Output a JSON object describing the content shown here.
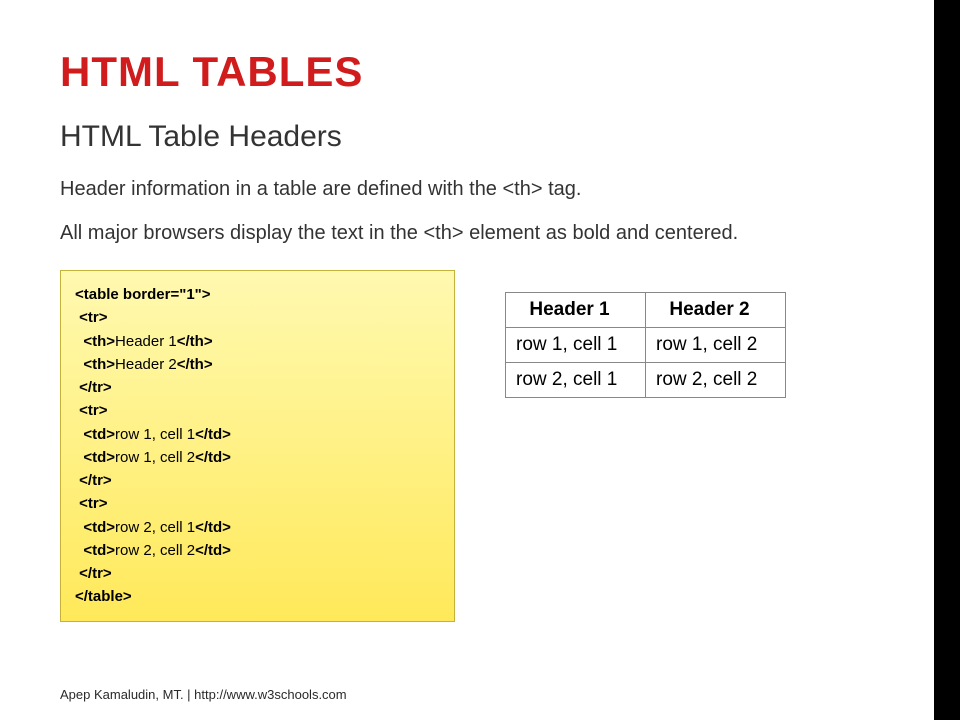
{
  "title": "HTML TABLES",
  "subtitle": "HTML Table Headers",
  "para1": "Header information in a table are defined with the <th> tag.",
  "para2": "All major browsers display the text in the <th> element as bold and centered.",
  "code": {
    "l1": "<table border=\"1\">",
    "l2": " <tr>",
    "l3a": "  <th>",
    "l3b": "Header 1",
    "l3c": "</th>",
    "l4a": "  <th>",
    "l4b": "Header 2",
    "l4c": "</th>",
    "l5": " </tr>",
    "l6": " <tr>",
    "l7a": "  <td>",
    "l7b": "row 1, cell 1",
    "l7c": "</td>",
    "l8a": "  <td>",
    "l8b": "row 1, cell 2",
    "l8c": "</td>",
    "l9": " </tr>",
    "l10": " <tr>",
    "l11a": "  <td>",
    "l11b": "row 2, cell 1",
    "l11c": "</td>",
    "l12a": "  <td>",
    "l12b": "row 2, cell 2",
    "l12c": "</td>",
    "l13": " </tr>",
    "l14": "</table>"
  },
  "demo": {
    "h1": "Header 1",
    "h2": "Header 2",
    "r1c1": "row 1, cell 1",
    "r1c2": "row 1, cell 2",
    "r2c1": "row 2, cell 1",
    "r2c2": "row 2, cell 2"
  },
  "footer": "Apep Kamaludin, MT.  |  http://www.w3schools.com"
}
